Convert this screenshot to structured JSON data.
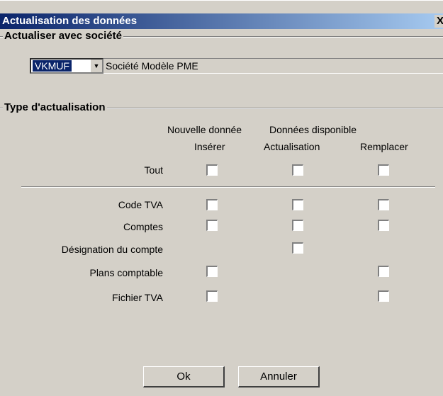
{
  "window": {
    "title": "Actualisation des données",
    "close_label": "X"
  },
  "company_group": {
    "title": "Actualiser avec société",
    "combo_value": "VKMUF",
    "combo_arrow": "▼",
    "company_name": "Société Modèle PME"
  },
  "type_group": {
    "title": "Type d'actualisation",
    "header_new": "Nouvelle donnée",
    "header_available": "Données disponible",
    "col_insert": "Insérer",
    "col_update": "Actualisation",
    "col_replace": "Remplacer",
    "all_label": "Tout",
    "rows": [
      {
        "label": "Code TVA"
      },
      {
        "label": "Comptes"
      },
      {
        "label": "Désignation du compte"
      },
      {
        "label": "Plans comptable"
      },
      {
        "label": "Fichier TVA"
      }
    ]
  },
  "buttons": {
    "ok": "Ok",
    "cancel": "Annuler"
  }
}
